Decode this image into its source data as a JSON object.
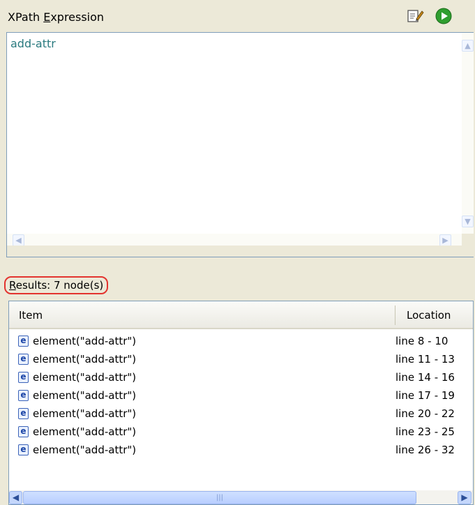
{
  "header": {
    "title_prefix": "XPath ",
    "title_mnemonic": "E",
    "title_suffix": "xpression",
    "edit_icon": "edit-expression-icon",
    "run_icon": "run-icon"
  },
  "expression": {
    "value": "add-attr",
    "text_color": "#2a7a7f"
  },
  "results": {
    "label_mnemonic": "R",
    "label_rest": "esults:  7 node(s)",
    "highlight_color": "#e3342f"
  },
  "table": {
    "columns": [
      "Item",
      "Location"
    ],
    "rows": [
      {
        "icon": "e",
        "item": "element(\"add-attr\")",
        "location": "line 8 - 10"
      },
      {
        "icon": "e",
        "item": "element(\"add-attr\")",
        "location": "line 11 - 13"
      },
      {
        "icon": "e",
        "item": "element(\"add-attr\")",
        "location": "line 14 - 16"
      },
      {
        "icon": "e",
        "item": "element(\"add-attr\")",
        "location": "line 17 - 19"
      },
      {
        "icon": "e",
        "item": "element(\"add-attr\")",
        "location": "line 20 - 22"
      },
      {
        "icon": "e",
        "item": "element(\"add-attr\")",
        "location": "line 23 - 25"
      },
      {
        "icon": "e",
        "item": "element(\"add-attr\")",
        "location": "line 26 - 32"
      }
    ]
  }
}
